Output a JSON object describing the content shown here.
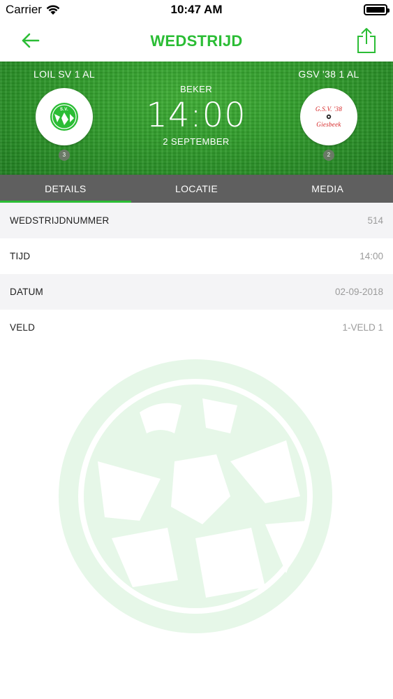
{
  "status_bar": {
    "carrier": "Carrier",
    "time": "10:47 AM"
  },
  "nav": {
    "title": "WEDSTRIJD",
    "back_icon": "arrow-left-icon",
    "share_icon": "share-icon",
    "accent_color": "#2bbd35"
  },
  "match": {
    "home_team": "LOIL SV 1 AL",
    "away_team": "GSV '38 1 AL",
    "home_rank": "3",
    "away_rank": "2",
    "competition": "BEKER",
    "time": "14:00",
    "date": "2 SEPTEMBER",
    "home_logo_text": "S.V.",
    "away_logo_top": "G.S.V. '38",
    "away_logo_bottom": "Giesbeek"
  },
  "tabs": [
    {
      "label": "DETAILS",
      "active": true
    },
    {
      "label": "LOCATIE",
      "active": false
    },
    {
      "label": "MEDIA",
      "active": false
    }
  ],
  "details": [
    {
      "label": "WEDSTRIJDNUMMER",
      "value": "514"
    },
    {
      "label": "TIJD",
      "value": "14:00"
    },
    {
      "label": "DATUM",
      "value": "02-09-2018"
    },
    {
      "label": "VELD",
      "value": "1-VELD 1"
    }
  ]
}
